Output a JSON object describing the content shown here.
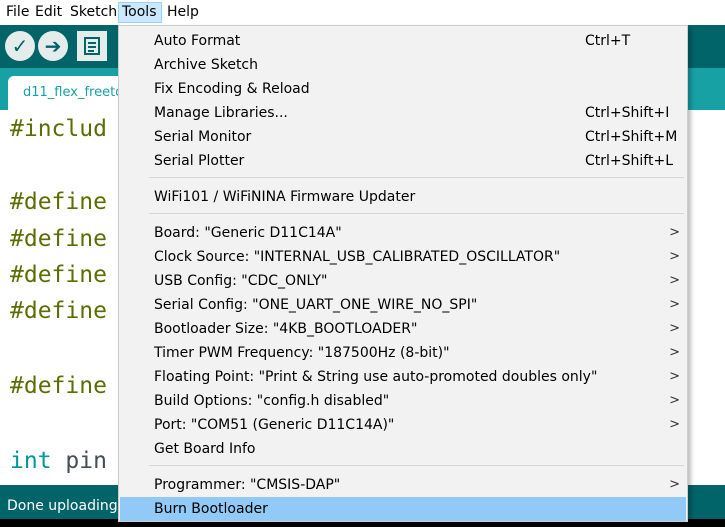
{
  "menubar": {
    "items": [
      {
        "label": "File"
      },
      {
        "label": "Edit"
      },
      {
        "label": "Sketch"
      },
      {
        "label": "Tools"
      },
      {
        "label": "Help"
      }
    ]
  },
  "toolbar": {
    "verify_icon": "check-icon",
    "upload_icon": "arrow-right-icon",
    "new_icon": "document-icon"
  },
  "tab": {
    "label": "d11_flex_freeto"
  },
  "editor": {
    "lines": [
      {
        "prefix": "#includ",
        "rest": ""
      },
      {
        "prefix": "#define",
        "rest": ""
      },
      {
        "prefix": "#define",
        "rest": ""
      },
      {
        "prefix": "#define",
        "rest": ""
      },
      {
        "prefix": "#define",
        "rest": ""
      },
      {
        "prefix": "#define",
        "rest": ""
      },
      {
        "prefix": "int",
        "rest": " pin"
      }
    ]
  },
  "status": {
    "text": "Done uploading."
  },
  "tools_menu": {
    "items": [
      {
        "label": "Auto Format",
        "shortcut": "Ctrl+T",
        "submenu": false
      },
      {
        "label": "Archive Sketch",
        "shortcut": "",
        "submenu": false
      },
      {
        "label": "Fix Encoding & Reload",
        "shortcut": "",
        "submenu": false
      },
      {
        "label": "Manage Libraries...",
        "shortcut": "Ctrl+Shift+I",
        "submenu": false
      },
      {
        "label": "Serial Monitor",
        "shortcut": "Ctrl+Shift+M",
        "submenu": false
      },
      {
        "label": "Serial Plotter",
        "shortcut": "Ctrl+Shift+L",
        "submenu": false
      },
      {
        "label": "WiFi101 / WiFiNINA Firmware Updater",
        "shortcut": "",
        "submenu": false
      },
      {
        "label": "Board: \"Generic D11C14A\"",
        "shortcut": "",
        "submenu": true
      },
      {
        "label": "Clock Source: \"INTERNAL_USB_CALIBRATED_OSCILLATOR\"",
        "shortcut": "",
        "submenu": true
      },
      {
        "label": "USB Config: \"CDC_ONLY\"",
        "shortcut": "",
        "submenu": true
      },
      {
        "label": "Serial Config: \"ONE_UART_ONE_WIRE_NO_SPI\"",
        "shortcut": "",
        "submenu": true
      },
      {
        "label": "Bootloader Size: \"4KB_BOOTLOADER\"",
        "shortcut": "",
        "submenu": true
      },
      {
        "label": "Timer PWM Frequency: \"187500Hz (8-bit)\"",
        "shortcut": "",
        "submenu": true
      },
      {
        "label": "Floating Point: \"Print & String use auto-promoted doubles only\"",
        "shortcut": "",
        "submenu": true
      },
      {
        "label": "Build Options: \"config.h disabled\"",
        "shortcut": "",
        "submenu": true
      },
      {
        "label": "Port: \"COM51 (Generic D11C14A)\"",
        "shortcut": "",
        "submenu": true
      },
      {
        "label": "Get Board Info",
        "shortcut": "",
        "submenu": false
      },
      {
        "label": "Programmer: \"CMSIS-DAP\"",
        "shortcut": "",
        "submenu": true
      },
      {
        "label": "Burn Bootloader",
        "shortcut": "",
        "submenu": false
      }
    ],
    "submenu_arrow": ">"
  },
  "colors": {
    "toolbar": "#006468",
    "tabbar": "#17a1a5",
    "highlight": "#91c9f7",
    "menu_bg": "#f2f2f2",
    "preprocessor": "#5e6d03",
    "type_keyword": "#00979c"
  }
}
